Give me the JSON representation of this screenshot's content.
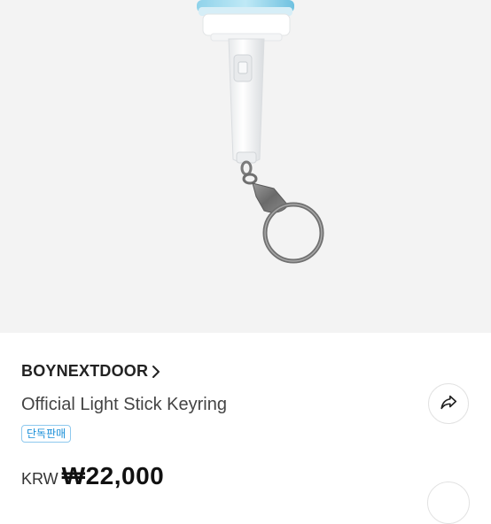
{
  "product": {
    "artist": "BOYNEXTDOOR",
    "title": "Official Light Stick Keyring",
    "badge": "단독판매",
    "currency": "KRW",
    "price": "₩22,000"
  },
  "icons": {
    "artist_chevron": "chevron-right-icon",
    "share": "share-icon"
  },
  "colors": {
    "badge_text": "#1a8fd8",
    "badge_border": "#8ec9ee",
    "image_background": "#f3f3f3"
  }
}
